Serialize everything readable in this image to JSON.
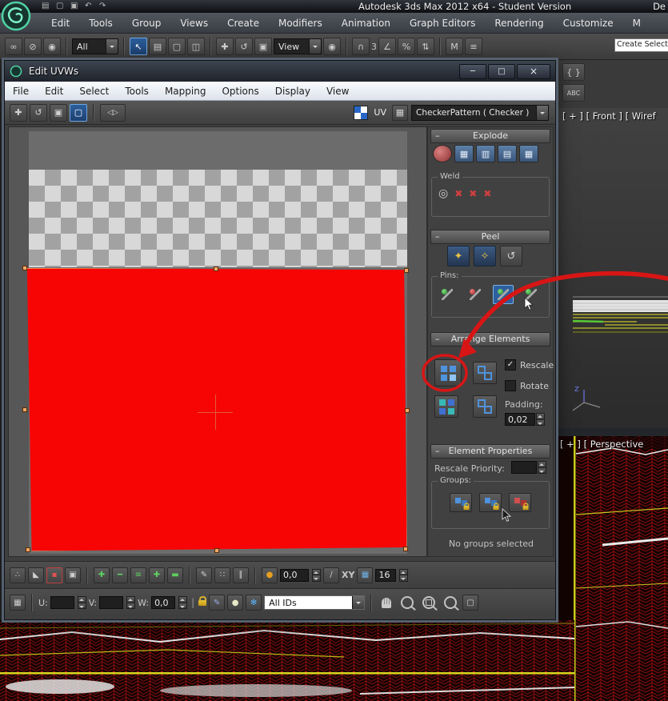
{
  "titlebar": {
    "title": "Autodesk 3ds Max  2012 x64  - Student Version",
    "right": "De"
  },
  "menubar": {
    "items": [
      "Edit",
      "Tools",
      "Group",
      "Views",
      "Create",
      "Modifiers",
      "Animation",
      "Graph Editors",
      "Rendering",
      "Customize",
      "M"
    ]
  },
  "main_toolbar": {
    "selection_filter": "All",
    "coord_system": "View",
    "snap_value": "3",
    "named_selection": "Create Selection"
  },
  "side_icons": {
    "script": "{ }",
    "spell": "ABC"
  },
  "uvw": {
    "title": "Edit UVWs",
    "menu": [
      "File",
      "Edit",
      "Select",
      "Tools",
      "Mapping",
      "Options",
      "Display",
      "View"
    ],
    "toolbar": {
      "uv_label": "UV",
      "map_dropdown": "CheckerPattern  ( Checker )"
    },
    "explode": {
      "title": "Explode",
      "weld_label": "Weld"
    },
    "peel": {
      "title": "Peel",
      "pins_label": "Pins:"
    },
    "arrange": {
      "title": "Arrange Elements",
      "rescale_label": "Rescale",
      "rotate_label": "Rotate",
      "padding_label": "Padding:",
      "padding_value": "0,02",
      "rescale_checked": true,
      "rotate_checked": false
    },
    "props": {
      "title": "Element Properties",
      "rescale_priority_label": "Rescale Priority:",
      "groups_label": "Groups:",
      "no_groups": "No groups selected"
    },
    "bottom1": {
      "falloff_value": "0,0",
      "axis_label": "XY",
      "grid_value": "16"
    },
    "bottom2": {
      "u_label": "U:",
      "v_label": "V:",
      "w_label": "W:",
      "w_value": "0,0",
      "ids_dropdown": "All IDs"
    }
  },
  "viewports": {
    "front_label": "[ + ] [ Front ] [ Wiref",
    "perspective_label": "[ + ] [ Perspective ",
    "gizmo_z": "z"
  },
  "colors": {
    "annotation_red": "#d81515",
    "uv_island_red": "#f70505",
    "selected_blue": "#2e5f9e"
  },
  "icons": {
    "minus": "–",
    "check": "✓",
    "new": "▤",
    "open": "▢",
    "save": "▣",
    "undo": "↶",
    "redo": "↷",
    "link": "∞",
    "unlink": "⊘",
    "bind": "◉",
    "select": "↖",
    "by_name": "▤",
    "region": "▢",
    "crossing": "◫",
    "move": "✚",
    "rotate": "↺",
    "scale": "▣",
    "magnet": "∩",
    "angle": "∠",
    "percent": "%",
    "spin_snap": "⇅",
    "mirror": "M",
    "align": "≡",
    "win_min": "─",
    "win_max": "□",
    "win_close": "×",
    "uvw_freeform": "▢",
    "uvw_mirror": "◁▷",
    "uv_grid": "▦",
    "grid1": "▦",
    "grid2": "▥",
    "grid3": "▤",
    "target_weld": "◎",
    "weld_x": "✖",
    "pelt": "✦",
    "pelt2": "✧",
    "reset": "↺",
    "soft_dots": "∴",
    "paint_tri": "◣",
    "sel_sq": "▪",
    "copy": "▣",
    "plus": "✚",
    "dash": "━",
    "lines": "≡",
    "bar": "▬",
    "brush": "✎",
    "dots": "∷",
    "slashes": "∥",
    "dot": "●",
    "slash": "∕",
    "grid_blue": "▦",
    "grid_gray": "▦",
    "freeze": "✻",
    "bulb": "●",
    "divider": "|"
  }
}
